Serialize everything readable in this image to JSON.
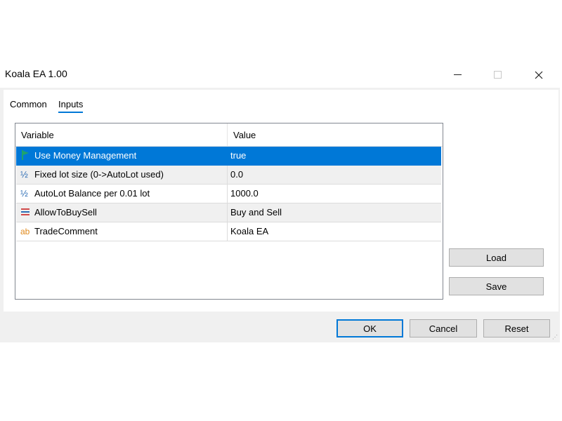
{
  "window": {
    "title": "Koala EA 1.00",
    "controls": {
      "minimize": "minimize-icon",
      "maximize": "maximize-icon",
      "close": "close-icon"
    }
  },
  "tabs": [
    {
      "label": "Common",
      "active": false
    },
    {
      "label": "Inputs",
      "active": true
    }
  ],
  "table": {
    "headers": [
      "Variable",
      "Value"
    ],
    "rows": [
      {
        "icon": "flag-icon",
        "variable": "Use Money Management",
        "value": "true",
        "selected": true
      },
      {
        "icon": "fraction-icon",
        "variable": "Fixed lot size (0->AutoLot used)",
        "value": "0.0"
      },
      {
        "icon": "fraction-icon",
        "variable": "AutoLot Balance per 0.01 lot",
        "value": "1000.0"
      },
      {
        "icon": "list-icon",
        "variable": "AllowToBuySell",
        "value": "Buy and Sell"
      },
      {
        "icon": "text-icon",
        "variable": "TradeComment",
        "value": "Koala EA"
      }
    ]
  },
  "side_buttons": {
    "load": "Load",
    "save": "Save"
  },
  "footer_buttons": {
    "ok": "OK",
    "cancel": "Cancel",
    "reset": "Reset"
  },
  "colors": {
    "accent": "#0078d7",
    "selected_text": "#ffffff",
    "flag": "#1fa36b",
    "fraction": "#2d6db5",
    "list": "#d04a4a",
    "text_icon": "#e0891b"
  }
}
